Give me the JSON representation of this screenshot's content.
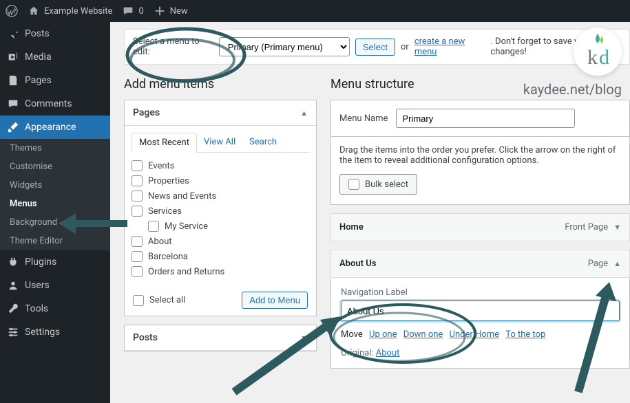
{
  "adminbar": {
    "site_name": "Example Website",
    "comments_count": "0",
    "new_label": "New"
  },
  "sidebar": {
    "items": [
      {
        "label": "Posts"
      },
      {
        "label": "Media"
      },
      {
        "label": "Pages"
      },
      {
        "label": "Comments"
      },
      {
        "label": "Appearance"
      },
      {
        "label": "Plugins"
      },
      {
        "label": "Users"
      },
      {
        "label": "Tools"
      },
      {
        "label": "Settings"
      }
    ],
    "submenu": [
      {
        "label": "Themes"
      },
      {
        "label": "Customise"
      },
      {
        "label": "Widgets"
      },
      {
        "label": "Menus"
      },
      {
        "label": "Background"
      },
      {
        "label": "Theme Editor"
      }
    ]
  },
  "selectbar": {
    "label": "Select a menu to edit:",
    "selected": "Primary (Primary menu)",
    "select_btn": "Select",
    "or": "or",
    "create_link": "create a new menu",
    "tail": ". Don't forget to save your changes!"
  },
  "left": {
    "heading": "Add menu items",
    "pages_box": {
      "title": "Pages",
      "tabs": {
        "recent": "Most Recent",
        "all": "View All",
        "search": "Search"
      },
      "items": [
        "Events",
        "Properties",
        "News and Events",
        "Services",
        "My Service",
        "About",
        "Barcelona",
        "Orders and Returns"
      ],
      "select_all": "Select all",
      "add_btn": "Add to Menu"
    },
    "posts_box": {
      "title": "Posts"
    }
  },
  "right": {
    "heading": "Menu structure",
    "name_label": "Menu Name",
    "name_value": "Primary",
    "drag_hint": "Drag the items into the order you prefer. Click the arrow on the right of the item to reveal additional configuration options.",
    "bulk_label": "Bulk select",
    "items": [
      {
        "title": "Home",
        "type": "Front Page"
      },
      {
        "title": "About Us",
        "type": "Page"
      }
    ],
    "nav_label_field": "Navigation Label",
    "nav_label_value": "About Us",
    "move_label": "Move",
    "move_links": [
      "Up one",
      "Down one",
      "Under Home",
      "To the top"
    ],
    "original_label": "Original:",
    "original_link": "About"
  },
  "watermark": {
    "logo_k": "k",
    "logo_d": "d",
    "text": "kaydee.net/blog"
  }
}
